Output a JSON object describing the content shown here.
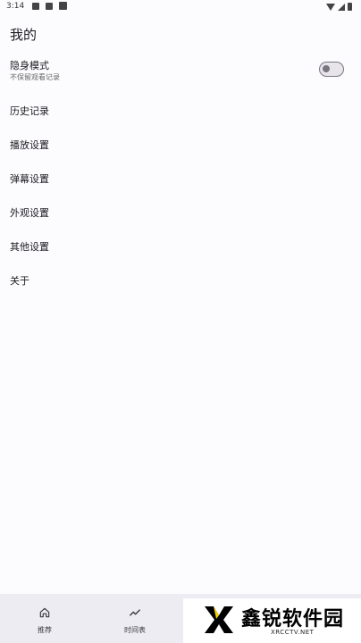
{
  "status_bar": {
    "time": "3:14"
  },
  "page": {
    "title": "我的"
  },
  "incognito": {
    "label": "隐身模式",
    "sublabel": "不保留观看记录",
    "enabled": false
  },
  "menu": [
    {
      "label": "历史记录"
    },
    {
      "label": "播放设置"
    },
    {
      "label": "弹幕设置"
    },
    {
      "label": "外观设置"
    },
    {
      "label": "其他设置"
    },
    {
      "label": "关于"
    }
  ],
  "bottom_nav": [
    {
      "label": "推荐",
      "icon": "home-icon"
    },
    {
      "label": "时间表",
      "icon": "trending-icon"
    }
  ],
  "watermark": {
    "title": "鑫锐软件园",
    "subtitle": "XRCCTV.NET"
  }
}
